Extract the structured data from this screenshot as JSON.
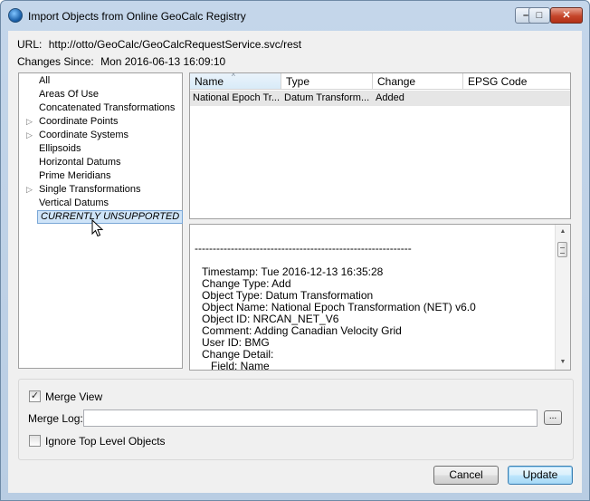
{
  "window": {
    "title": "Import Objects from Online GeoCalc Registry",
    "controls": {
      "minimize": "–",
      "maximize": "□",
      "close": "✕"
    }
  },
  "info": {
    "url_label": "URL:",
    "url_value": "http://otto/GeoCalc/GeoCalcRequestService.svc/rest",
    "changes_label": "Changes Since:",
    "changes_value": "Mon 2016-06-13 16:09:10"
  },
  "tree": {
    "items": [
      {
        "label": "All",
        "expandable": false,
        "selected": false
      },
      {
        "label": "Areas Of Use",
        "expandable": false,
        "selected": false
      },
      {
        "label": "Concatenated Transformations",
        "expandable": false,
        "selected": false
      },
      {
        "label": "Coordinate Points",
        "expandable": true,
        "selected": false
      },
      {
        "label": "Coordinate Systems",
        "expandable": true,
        "selected": false
      },
      {
        "label": "Ellipsoids",
        "expandable": false,
        "selected": false
      },
      {
        "label": "Horizontal Datums",
        "expandable": false,
        "selected": false
      },
      {
        "label": "Prime Meridians",
        "expandable": false,
        "selected": false
      },
      {
        "label": "Single Transformations",
        "expandable": true,
        "selected": false
      },
      {
        "label": "Vertical Datums",
        "expandable": false,
        "selected": false
      },
      {
        "label": "CURRENTLY UNSUPPORTED",
        "expandable": false,
        "selected": true
      }
    ],
    "expander_glyph": "▷"
  },
  "grid": {
    "columns": [
      "Name",
      "Type",
      "Change",
      "EPSG Code"
    ],
    "sort_indicator": "^",
    "rows": [
      [
        "National Epoch Tr...",
        "Datum Transform...",
        "Added",
        ""
      ]
    ]
  },
  "detail": {
    "lines": [
      "------------------------------------------------------------",
      "",
      "Timestamp: Tue 2016-12-13 16:35:28",
      "Change Type: Add",
      "Object Type: Datum Transformation",
      "Object Name: National Epoch Transformation (NET) v6.0",
      "Object ID: NRCAN_NET_V6",
      "Comment: Adding Canadian Velocity Grid",
      "User ID: BMG",
      "Change Detail:",
      "   Field: Name"
    ],
    "scroll_up": "▲",
    "scroll_down": "▼"
  },
  "options": {
    "merge_view_label": "Merge View",
    "merge_view_checked": true,
    "merge_log_label": "Merge Log:",
    "merge_log_value": "",
    "browse_label": "...",
    "ignore_top_label": "Ignore Top Level Objects",
    "ignore_top_checked": false,
    "check_glyph": "✓"
  },
  "buttons": {
    "cancel": "Cancel",
    "update": "Update"
  }
}
